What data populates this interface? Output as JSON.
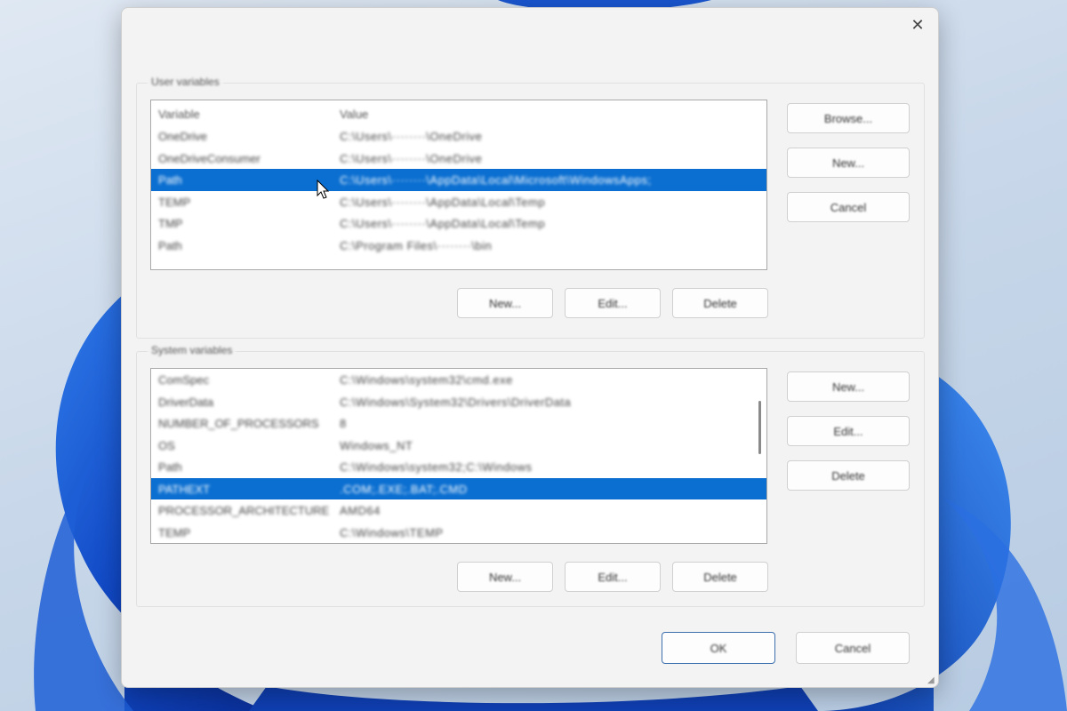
{
  "dialog": {
    "close_glyph": "✕",
    "ok_label": "OK",
    "cancel_label": "Cancel"
  },
  "user_vars": {
    "group_title": "User variables",
    "columns": [
      "Variable",
      "Value"
    ],
    "rows": [
      {
        "name": "OneDrive",
        "value": "C:\\Users\\········\\OneDrive",
        "selected": false
      },
      {
        "name": "OneDriveConsumer",
        "value": "C:\\Users\\········\\OneDrive",
        "selected": false
      },
      {
        "name": "Path",
        "value": "C:\\Users\\········\\AppData\\Local\\Microsoft\\WindowsApps;",
        "selected": true
      },
      {
        "name": "TEMP",
        "value": "C:\\Users\\········\\AppData\\Local\\Temp",
        "selected": false
      },
      {
        "name": "TMP",
        "value": "C:\\Users\\········\\AppData\\Local\\Temp",
        "selected": false
      },
      {
        "name": "Path",
        "value": "C:\\Program Files\\········\\bin",
        "selected": false
      }
    ],
    "side_buttons": [
      "Browse...",
      "New...",
      "Cancel"
    ],
    "new_label": "New...",
    "edit_label": "Edit...",
    "delete_label": "Delete"
  },
  "system_vars": {
    "group_title": "System variables",
    "columns": [
      "Variable",
      "Value"
    ],
    "rows": [
      {
        "name": "ComSpec",
        "value": "C:\\Windows\\system32\\cmd.exe",
        "selected": false
      },
      {
        "name": "DriverData",
        "value": "C:\\Windows\\System32\\Drivers\\DriverData",
        "selected": false
      },
      {
        "name": "NUMBER_OF_PROCESSORS",
        "value": "8",
        "selected": false
      },
      {
        "name": "OS",
        "value": "Windows_NT",
        "selected": false
      },
      {
        "name": "Path",
        "value": "C:\\Windows\\system32;C:\\Windows",
        "selected": false
      },
      {
        "name": "PATHEXT",
        "value": ".COM;.EXE;.BAT;.CMD",
        "selected": true
      },
      {
        "name": "PROCESSOR_ARCHITECTURE",
        "value": "AMD64",
        "selected": false
      },
      {
        "name": "TEMP",
        "value": "C:\\Windows\\TEMP",
        "selected": false
      }
    ],
    "side_buttons": [
      "New...",
      "Edit...",
      "Delete"
    ],
    "new_label": "New...",
    "edit_label": "Edit...",
    "delete_label": "Delete"
  },
  "colors": {
    "selection": "#0b6fd1",
    "wallpaper_accent": "#1450c8"
  }
}
